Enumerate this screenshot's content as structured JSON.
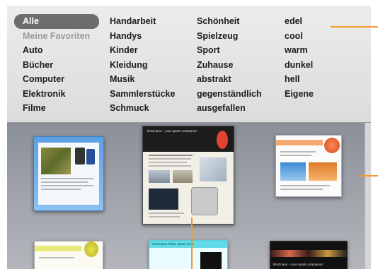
{
  "categories": {
    "col1": [
      "Alle",
      "Meine Favoriten",
      "Auto",
      "Bücher",
      "Computer",
      "Elektronik",
      "Filme"
    ],
    "col2": [
      "Handarbeit",
      "Handys",
      "Kinder",
      "Kleidung",
      "Musik",
      "Sammlerstücke",
      "Schmuck"
    ],
    "col3": [
      "Schönheit",
      "Spielzeug",
      "Sport",
      "Zuhause",
      "abstrakt",
      "gegenständlich",
      "ausgefallen"
    ],
    "col4": [
      "edel",
      "cool",
      "warm",
      "dunkel",
      "hell",
      "Eigene"
    ],
    "selected": "Alle",
    "dimmed": "Meine Favoriten"
  },
  "templates": {
    "center_header": "iPod nano – your sports companion",
    "bottom_right_header": "iPod nano – your sports companion",
    "bottom_center_header": "iPod nano reflow, stand, wear"
  },
  "colors": {
    "callout": "#f39a2b",
    "selection": "#6d6d6d",
    "browser_bg": "#9a9da5"
  }
}
